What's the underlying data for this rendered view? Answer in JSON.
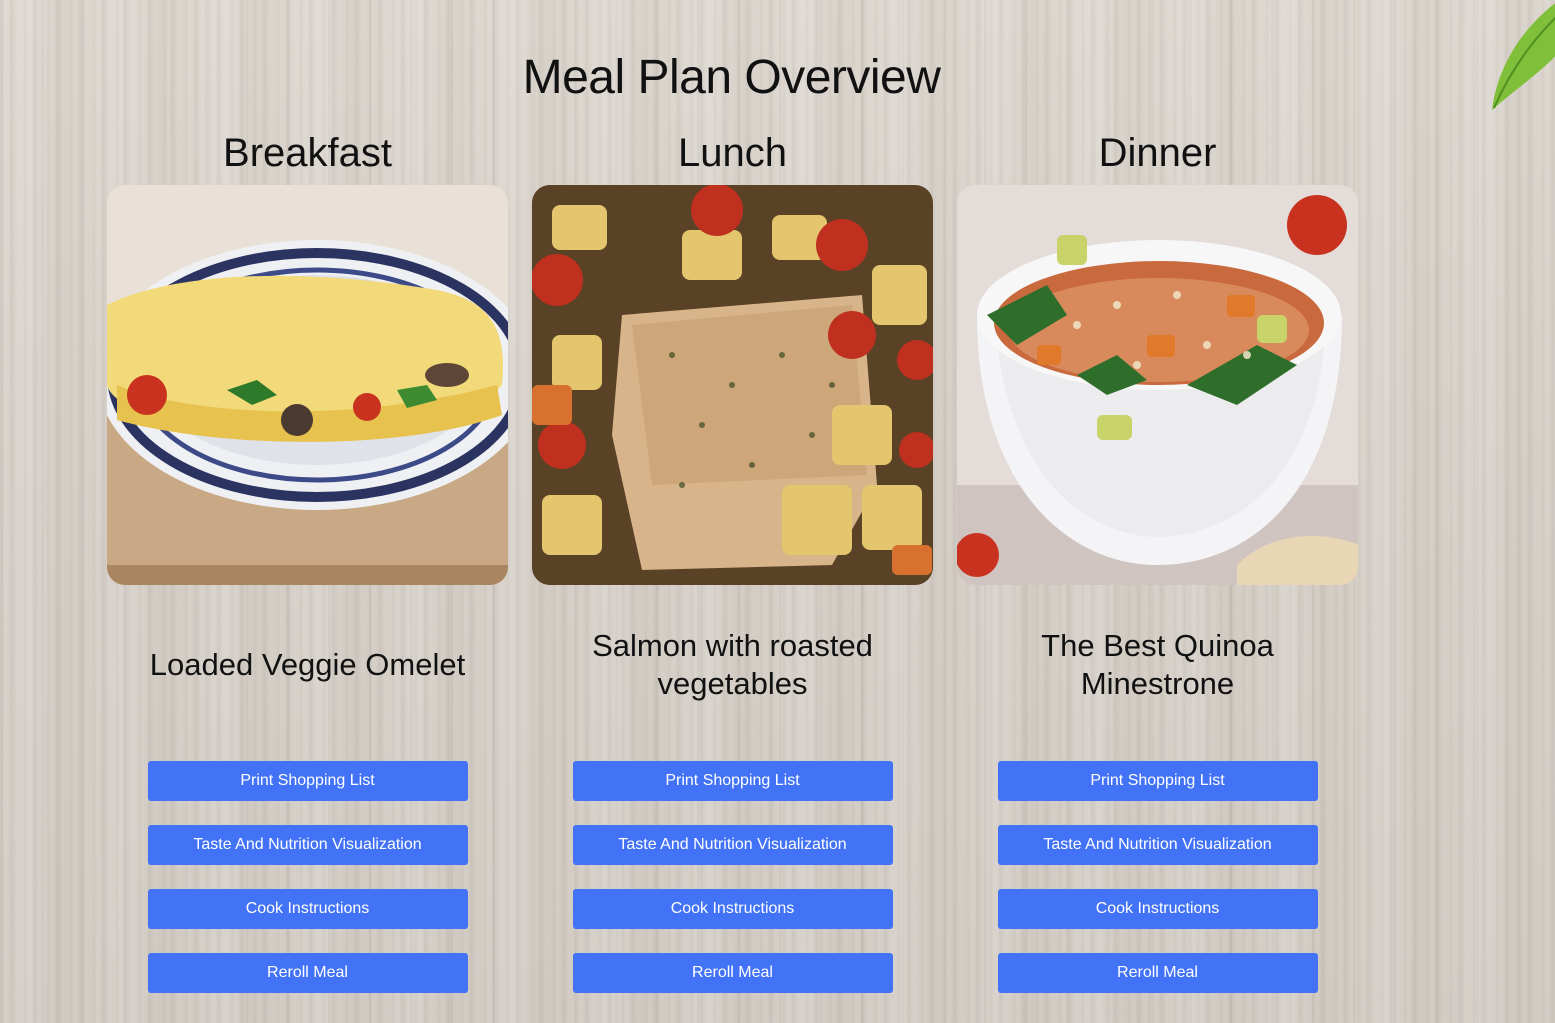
{
  "page": {
    "title": "Meal Plan Overview"
  },
  "meals": [
    {
      "heading": "Breakfast",
      "name": "Loaded Veggie Omelet",
      "image": "omelet-photo"
    },
    {
      "heading": "Lunch",
      "name": "Salmon with roasted vegetables",
      "image": "salmon-roasted-vegetables-photo"
    },
    {
      "heading": "Dinner",
      "name": "The Best Quinoa Minestrone",
      "image": "quinoa-minestrone-photo"
    }
  ],
  "buttons": {
    "shopping": "Print Shopping List",
    "nutrition": "Taste And Nutrition Visualization",
    "instructions": "Cook Instructions",
    "reroll": "Reroll Meal"
  },
  "colors": {
    "button": "#4272f6",
    "background": "#d9d3cc",
    "text": "#111111"
  }
}
